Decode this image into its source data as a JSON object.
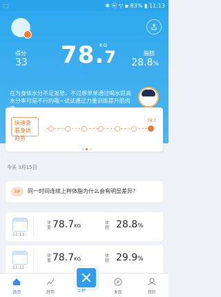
{
  "status": {
    "right": "✱ ⦿ ▽ ▪ 83% ▮ 11:13"
  },
  "hero": {
    "score_label": "得分",
    "score_value": "33",
    "weight_int": "78.",
    "weight_dec": "7",
    "weight_unit": "KG",
    "fat_label": "脂肪",
    "fat_value": "28.8",
    "fat_unit": "%",
    "tip": "在为身体水分不足发愁，不过想单单通过喝水提高水分率可是不行的哦~试试通过力量训练提升肌肉率~"
  },
  "trend": {
    "label": "快速查看身体趋势",
    "last_value": "78.7"
  },
  "date": "今天 3月15日",
  "tip_card": {
    "badge": "TIP",
    "question": "同一时间连续上秤体脂为什么会有明显差异?"
  },
  "records": [
    {
      "time": "11:13",
      "w_label": "体重",
      "weight": "78.7",
      "w_unit": "KG",
      "f_label": "体脂",
      "fat": "28.8",
      "f_unit": "%"
    },
    {
      "time": "11:12",
      "w_label": "体重",
      "weight": "78.7",
      "w_unit": "KG",
      "f_label": "体脂",
      "fat": "29.9",
      "f_unit": "%"
    }
  ],
  "nav": [
    "首页",
    "趋势",
    "上秤",
    "发现",
    "我的"
  ],
  "colors": {
    "primary": "#2ea8ee",
    "accent": "#f07a2b"
  }
}
